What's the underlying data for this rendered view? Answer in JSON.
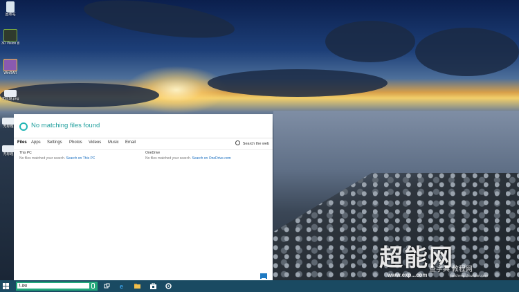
{
  "desktop": {
    "icons": [
      {
        "label": "回收站"
      },
      {
        "label": "3D Vision 照片查看器"
      },
      {
        "label": "WinRAR"
      },
      {
        "label": "无标题.png"
      },
      {
        "label": "无标题"
      },
      {
        "label": "无标题"
      }
    ],
    "watermark": "超能网",
    "watermark_url": "www.exp...com",
    "watermark2": "查字典 教程网",
    "watermark2_url": "jiaocheng.chazidian.com"
  },
  "search_panel": {
    "status": "No matching files found",
    "tabs": [
      "Files",
      "Apps",
      "Settings",
      "Photos",
      "Videos",
      "Music",
      "Email"
    ],
    "active_tab": "Files",
    "search_web": "Search the web",
    "results": [
      {
        "title": "This PC",
        "message": "No files matched your search.",
        "link": "Search on This PC"
      },
      {
        "title": "OneDrive",
        "message": "No files matched your search.",
        "link": "Search on OneDrive.com"
      }
    ]
  },
  "taskbar": {
    "search_value": "1.jpg",
    "icons": [
      "task-view-icon",
      "edge-icon",
      "file-explorer-icon",
      "store-icon",
      "settings-icon"
    ]
  },
  "colors": {
    "accent": "#20b5b4",
    "search_box": "#22a87b",
    "taskbar": "#1a4a62",
    "link": "#1a6fc0"
  }
}
